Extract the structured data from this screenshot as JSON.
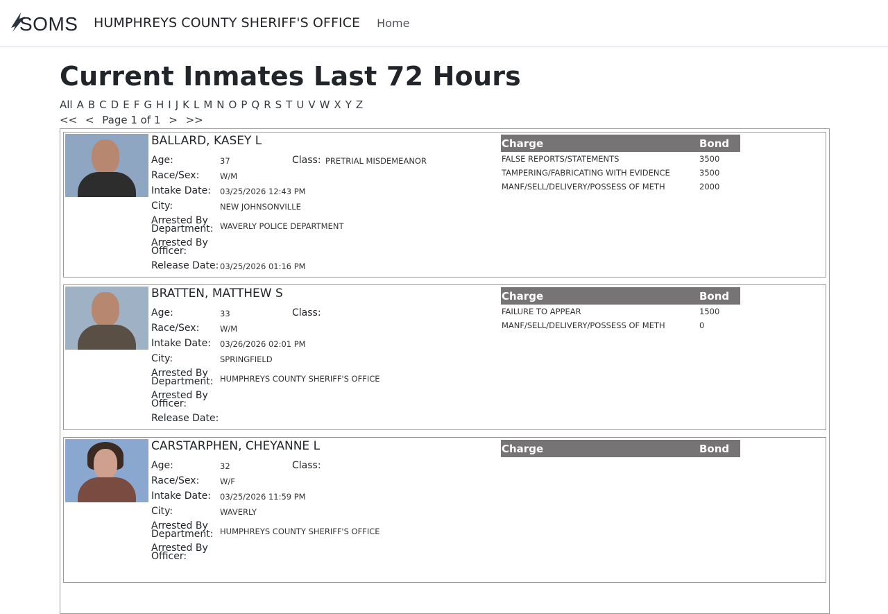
{
  "navbar": {
    "logo_text": "SOMS",
    "title": "HUMPHREYS COUNTY SHERIFF'S OFFICE",
    "home": "Home"
  },
  "page": {
    "title": "Current Inmates Last 72 Hours",
    "alphabet": [
      "All",
      "A",
      "B",
      "C",
      "D",
      "E",
      "F",
      "G",
      "H",
      "I",
      "J",
      "K",
      "L",
      "M",
      "N",
      "O",
      "P",
      "Q",
      "R",
      "S",
      "T",
      "U",
      "V",
      "W",
      "X",
      "Y",
      "Z"
    ],
    "pager": {
      "first": "<<",
      "prev": "<",
      "label": "Page 1 of 1",
      "next": ">",
      "last": ">>"
    }
  },
  "labels": {
    "age": "Age:",
    "class": "Class:",
    "race_sex": "Race/Sex:",
    "intake": "Intake Date:",
    "city": "City:",
    "dept_1": "Arrested By",
    "dept_2": "Department:",
    "officer_1": "Arrested By",
    "officer_2": "Officer:",
    "release": "Release Date:",
    "charge": "Charge",
    "bond": "Bond"
  },
  "inmates": [
    {
      "name": "BALLARD, KASEY L",
      "age": "37",
      "class": "PRETRIAL MISDEMEANOR",
      "race_sex": "W/M",
      "intake": "03/25/2026 12:43 PM",
      "city": "NEW JOHNSONVILLE",
      "department": "WAVERLY POLICE DEPARTMENT",
      "officer": "",
      "release": "03/25/2026 01:16 PM",
      "charges": [
        {
          "charge": "FALSE REPORTS/STATEMENTS",
          "bond": "3500"
        },
        {
          "charge": "TAMPERING/FABRICATING WITH EVIDENCE",
          "bond": "3500"
        },
        {
          "charge": "MANF/SELL/DELIVERY/POSSESS OF METH",
          "bond": "2000"
        }
      ]
    },
    {
      "name": "BRATTEN, MATTHEW S",
      "age": "33",
      "class": "",
      "race_sex": "W/M",
      "intake": "03/26/2026 02:01 PM",
      "city": "SPRINGFIELD",
      "department": "HUMPHREYS COUNTY SHERIFF'S OFFICE",
      "officer": "",
      "release": "",
      "charges": [
        {
          "charge": "FAILURE TO APPEAR",
          "bond": "1500"
        },
        {
          "charge": "MANF/SELL/DELIVERY/POSSESS OF METH",
          "bond": "0"
        }
      ]
    },
    {
      "name": "CARSTARPHEN, CHEYANNE L",
      "age": "32",
      "class": "",
      "race_sex": "W/F",
      "intake": "03/25/2026 11:59 PM",
      "city": "WAVERLY",
      "department": "HUMPHREYS COUNTY SHERIFF'S OFFICE",
      "officer": "",
      "release": "",
      "charges": []
    }
  ]
}
